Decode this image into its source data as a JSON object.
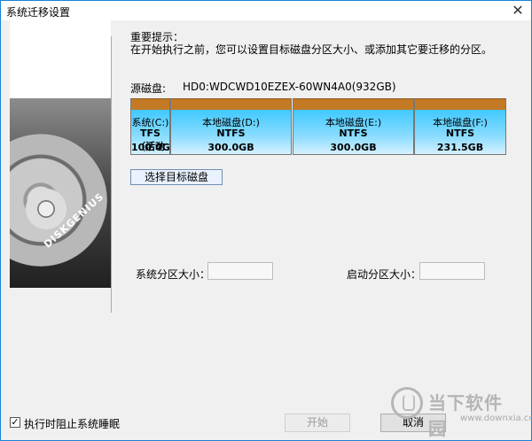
{
  "window": {
    "title": "系统迁移设置",
    "close_symbol": "✕"
  },
  "note": {
    "title": "重要提示：",
    "body": "在开始执行之前，您可以设置目标磁盘分区大小、或添加其它要迁移的分区。"
  },
  "source_disk": {
    "label": "源磁盘:",
    "value": "HD0:WDCWD10EZEX-60WN4A0(932GB)"
  },
  "partitions": [
    {
      "name": "系统(C:)",
      "fs": "TFS（活动",
      "size": "100.0GB"
    },
    {
      "name": "本地磁盘(D:)",
      "fs": "NTFS",
      "size": "300.0GB"
    },
    {
      "name": "本地磁盘(E:)",
      "fs": "NTFS",
      "size": "300.0GB"
    },
    {
      "name": "本地磁盘(F:)",
      "fs": "NTFS",
      "size": "231.5GB"
    }
  ],
  "buttons": {
    "select_target": "选择目标磁盘",
    "start": "开始",
    "cancel": "取消"
  },
  "fields": {
    "system_partition_size_label": "系统分区大小：",
    "boot_partition_size_label": "启动分区大小："
  },
  "checkbox": {
    "label": "执行时阻止系统睡眠",
    "checked": true,
    "mark": "✓"
  },
  "brand": {
    "text": "DISKGENIUS"
  },
  "watermark": {
    "main": "当下软件园",
    "url": "www.downxia.com"
  }
}
